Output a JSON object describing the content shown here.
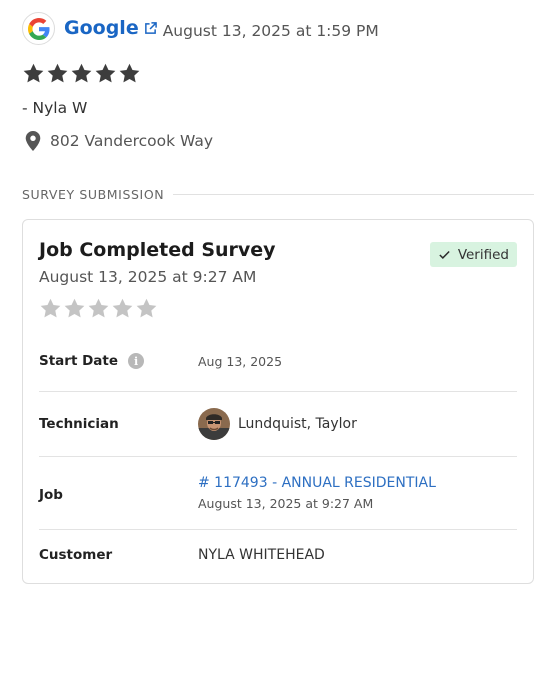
{
  "review": {
    "source": "Google",
    "timestamp": "August 13, 2025 at 1:59 PM",
    "rating": 5,
    "reviewer": "- Nyla W",
    "location": "802 Vandercook Way"
  },
  "section": {
    "label": "SURVEY SUBMISSION"
  },
  "survey": {
    "title": "Job Completed Survey",
    "date": "August 13, 2025 at 9:27 AM",
    "status": "Verified",
    "rating": 0,
    "fields": {
      "start_date": {
        "label": "Start Date",
        "value": "Aug 13, 2025"
      },
      "technician": {
        "label": "Technician",
        "value": "Lundquist, Taylor"
      },
      "job": {
        "label": "Job",
        "link": "# 117493 - ANNUAL RESIDENTIAL",
        "sub": "August 13, 2025 at 9:27 AM"
      },
      "customer": {
        "label": "Customer",
        "value": "NYLA WHITEHEAD"
      }
    }
  },
  "colors": {
    "link": "#1a66c4",
    "star_filled": "#3d3d3d",
    "star_empty": "#c4c4c4",
    "verified_bg": "#d8f3e0"
  },
  "icons": {
    "source": "google-g-icon",
    "external": "external-link-icon",
    "pin": "map-pin-icon",
    "info": "info-icon",
    "check": "check-icon"
  }
}
